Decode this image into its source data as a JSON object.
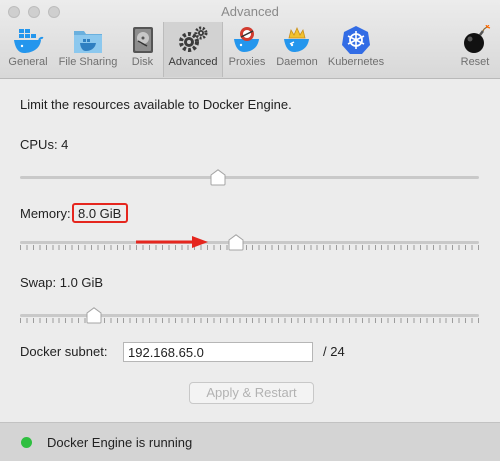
{
  "window": {
    "title": "Advanced"
  },
  "tabs": [
    {
      "label": "General",
      "icon": "docker-whale-icon"
    },
    {
      "label": "File Sharing",
      "icon": "folder-whale-icon"
    },
    {
      "label": "Disk",
      "icon": "disk-drive-icon"
    },
    {
      "label": "Advanced",
      "icon": "gears-icon",
      "selected": true
    },
    {
      "label": "Proxies",
      "icon": "proxies-whale-icon"
    },
    {
      "label": "Daemon",
      "icon": "daemon-whale-icon"
    },
    {
      "label": "Kubernetes",
      "icon": "kubernetes-helm-icon"
    },
    {
      "label": "Reset",
      "icon": "bomb-icon"
    }
  ],
  "intro": "Limit the resources available to Docker Engine.",
  "cpus": {
    "label": "CPUs: 4",
    "level": 0.43
  },
  "memory": {
    "label": "Memory:",
    "value": "8.0 GiB",
    "level": 0.47
  },
  "swap": {
    "label": "Swap: 1.0 GiB",
    "level": 0.15
  },
  "subnet": {
    "label": "Docker subnet:",
    "value": "192.168.65.0",
    "mask": "/ 24"
  },
  "apply_button": "Apply & Restart",
  "status": {
    "text": "Docker Engine is running",
    "color": "#2fbf40"
  },
  "colors": {
    "highlight": "#e5261e",
    "arrow": "#e5261e"
  }
}
